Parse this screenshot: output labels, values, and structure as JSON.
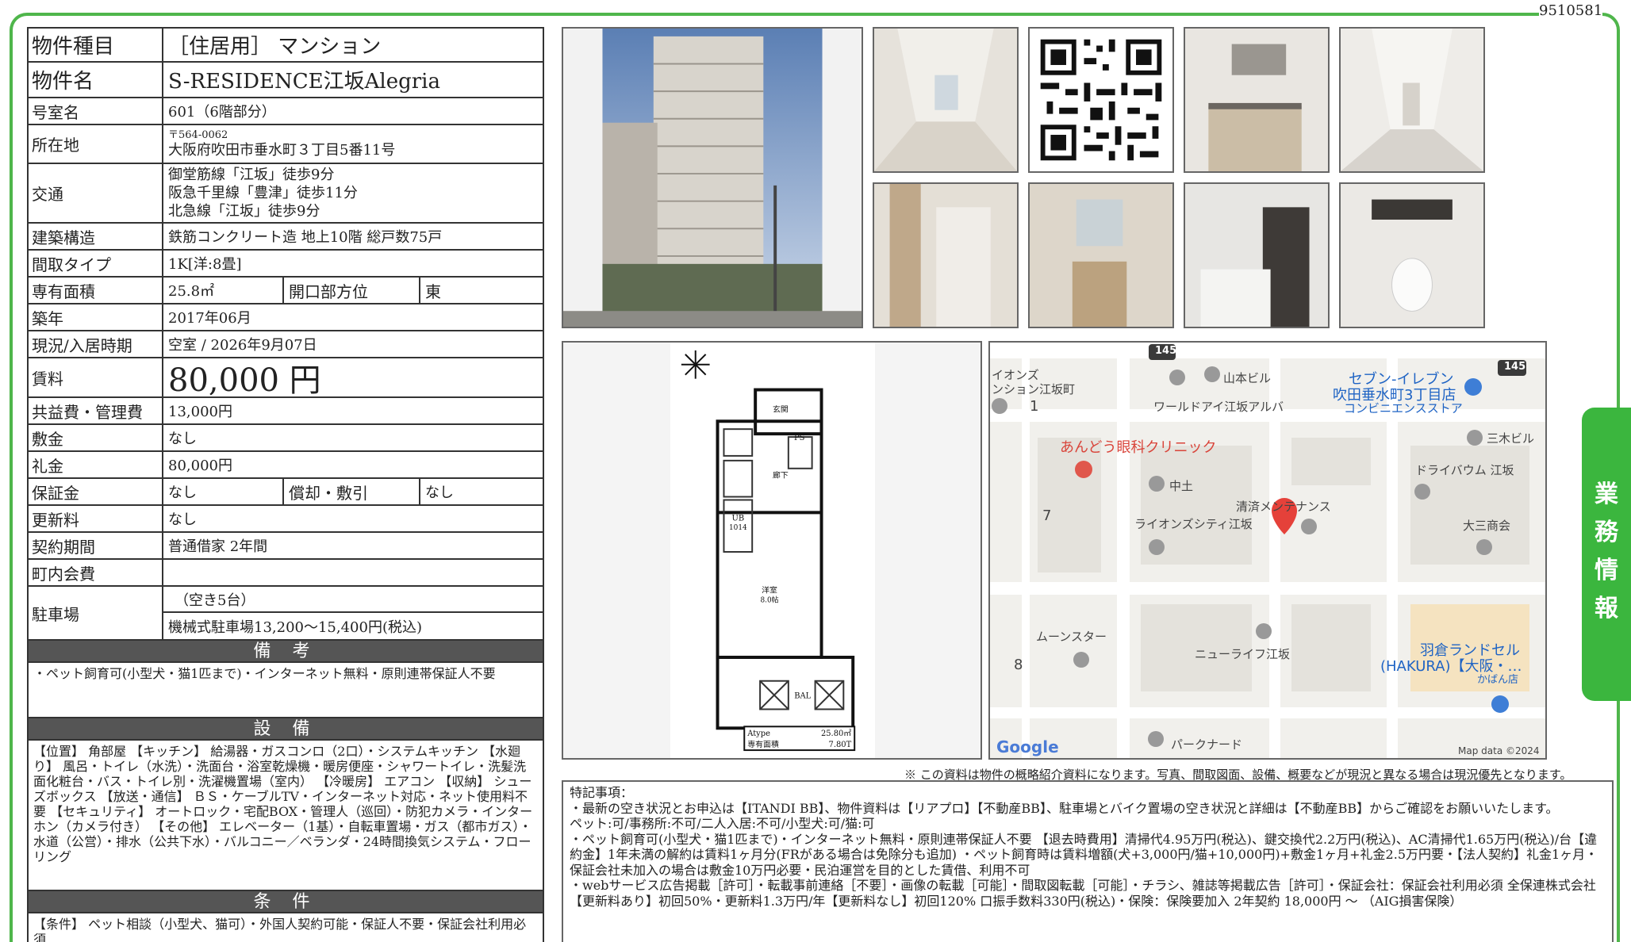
{
  "doc_id": "9510581",
  "side_tab": [
    "業",
    "務",
    "情",
    "報"
  ],
  "property": {
    "type_label": "物件種目",
    "type_value": "［住居用］ マンション",
    "name_label": "物件名",
    "name_value": "S-RESIDENCE江坂Alegria",
    "room_label": "号室名",
    "room_value": "601（6階部分）",
    "address_label": "所在地",
    "postal": "〒564-0062",
    "address": "大阪府吹田市垂水町３丁目5番11号",
    "traffic_label": "交通",
    "traffic": [
      "御堂筋線「江坂」徒歩9分",
      "阪急千里線「豊津」徒歩11分",
      "北急線「江坂」徒歩9分"
    ],
    "structure_label": "建築構造",
    "structure_value": "鉄筋コンクリート造 地上10階 総戸数75戸",
    "layout_label": "間取タイプ",
    "layout_value": "1K[洋:8畳]",
    "area_label": "専有面積",
    "area_value": "25.8㎡",
    "orientation_label": "開口部方位",
    "orientation_value": "東",
    "built_label": "築年",
    "built_value": "2017年06月",
    "status_label": "現況/入居時期",
    "status_value": "空室 / 2026年9月07日",
    "rent_label": "賃料",
    "rent_value": "80,000 円",
    "fee_label": "共益費・管理費",
    "fee_value": "13,000円",
    "deposit_label": "敷金",
    "deposit_value": "なし",
    "key_money_label": "礼金",
    "key_money_value": "80,000円",
    "guarantee_label": "保証金",
    "guarantee_value": "なし",
    "amort_label": "償却・敷引",
    "amort_value": "なし",
    "renewal_label": "更新料",
    "renewal_value": "なし",
    "contract_label": "契約期間",
    "contract_value": "普通借家 2年間",
    "town_fee_label": "町内会費",
    "town_fee_value": "",
    "parking_label": "駐車場",
    "parking_value1": "（空き5台）",
    "parking_value2": "機械式駐車場13,200〜15,400円(税込)"
  },
  "remarks_header": "備 考",
  "remarks_text": "・ペット飼育可(小型犬・猫1匹まで)・インターネット無料・原則連帯保証人不要",
  "facilities_header": "設 備",
  "facilities_text": "【位置】 角部屋 【キッチン】 給湯器・ガスコンロ（2口）・システムキッチン 【水廻り】 風呂・トイレ（水洗）・洗面台・浴室乾燥機・暖房便座・シャワートイレ・洗髪洗面化粧台・バス・トイレ別・洗濯機置場（室内） 【冷暖房】 エアコン 【収納】 シューズボックス 【放送・通信】 ＢＳ・ケーブルTV・インターネット対応・ネット使用料不要 【セキュリティ】 オートロック・宅配BOX・管理人（巡回）・防犯カメラ・インターホン（カメラ付き） 【その他】 エレベーター（1基）・自転車置場・ガス（都市ガス）・水道（公営）・排水（公共下水）・バルコニー／ベランダ・24時間換気システム・フローリング",
  "conditions_header": "条 件",
  "conditions_text": "【条件】 ペット相談（小型犬、猫可）・外国人契約可能・保証人不要・保証会社利用必須",
  "floorplan": {
    "type_label": "Atype",
    "area_label": "専有面積",
    "area1": "25.80㎡",
    "area2": "7.80T",
    "room": "洋室",
    "room_size": "8.0帖",
    "ub": "UB",
    "ub_size": "1014",
    "bal": "BAL",
    "entrance": "玄関",
    "hall": "廊下",
    "ps": "PS"
  },
  "map": {
    "labels": [
      "イオンズ",
      "ンション江坂町",
      "山本ビル",
      "ワールドアイ江坂アルバ",
      "セブン-イレブン",
      "吹田垂水町3丁目店",
      "コンビニエンスストア",
      "三木ビル",
      "あんどう眼科クリニック",
      "中土",
      "清済メンテナンス",
      "ドライバウム 江坂",
      "ライオンズシティ江坂",
      "大三商会",
      "ムーンスター",
      "ニューライフ江坂",
      "羽倉ランドセル",
      "(HAKURA)【大阪・…",
      "かばん店",
      "パークナード"
    ],
    "road1": "145",
    "road2": "145",
    "block_numbers": [
      "1",
      "7",
      "8"
    ],
    "google": "Google",
    "map_data": "Map data ©2024"
  },
  "disclaimer": "※ この資料は物件の概略紹介資料になります。写真、間取図面、設備、概要などが現況と異なる場合は現況優先となります。",
  "special_notes": [
    "特記事項：",
    "・最新の空き状況とお申込は【ITANDI BB】、物件資料は【リアプロ】【不動産BB】、駐車場とバイク置場の空き状況と詳細は【不動産BB】からご確認をお願いいたします。",
    "ペット:可/事務所:不可/二人入居:不可/小型犬:可/猫:可",
    "・ペット飼育可(小型犬・猫1匹まで)・インターネット無料・原則連帯保証人不要 【退去時費用】清掃代4.95万円(税込)、鍵交換代2.2万円(税込)、AC清掃代1.65万円(税込)/台【違約金】1年未満の解約は賃料1ヶ月分(FRがある場合は免除分も追加) ・ペット飼育時は賃料増額(犬+3,000円/猫+10,000円)+敷金1ヶ月+礼金2.5万円要・【法人契約】礼金1ヶ月・保証会社未加入の場合は敷金10万円必要・民泊運営を目的とした賃借、利用不可",
    "・webサービス広告掲載［許可］・転載事前連絡［不要］・画像の転載［可能］・間取図転載［可能］・チラシ、雑誌等掲載広告［許可］・保証会社：保証会社利用必須 全保連株式会社 【更新料あり】初回50%・更新料1.3万円/年【更新料なし】初回120% 口振手数料330円(税込)・保険：保険要加入 2年契約 18,000円 〜 （AIG損害保険）"
  ]
}
